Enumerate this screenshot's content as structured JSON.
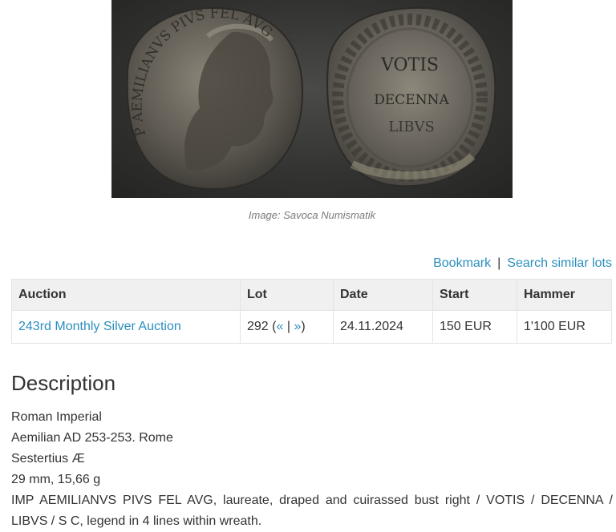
{
  "image": {
    "alt": "Coin obverse and reverse",
    "obverse_legend": "IMP AEMILIANVS PIVS FEL AVG",
    "reverse_lines": [
      "VOTIS",
      "DECENNA",
      "LIBVS"
    ],
    "caption": "Image: Savoca Numismatik"
  },
  "actions": {
    "bookmark": "Bookmark",
    "separator": "|",
    "search_similar": "Search similar lots"
  },
  "table": {
    "headers": {
      "auction": "Auction",
      "lot": "Lot",
      "date": "Date",
      "start": "Start",
      "hammer": "Hammer"
    },
    "row": {
      "auction": "243rd Monthly Silver Auction",
      "lot_number": "292",
      "lot_prev": "«",
      "lot_sep": "|",
      "lot_next": "»",
      "date": "24.11.2024",
      "start": "150 EUR",
      "hammer": "1'100 EUR"
    }
  },
  "description": {
    "title": "Description",
    "lines": [
      "Roman Imperial",
      "Aemilian AD 253-253. Rome",
      "Sestertius Æ",
      "29 mm, 15,66 g",
      "IMP AEMILIANVS PIVS FEL AVG, laureate, draped and cuirassed bust right / VOTIS / DECENNA /",
      "LIBVS / S C, legend in 4 lines within wreath."
    ]
  }
}
